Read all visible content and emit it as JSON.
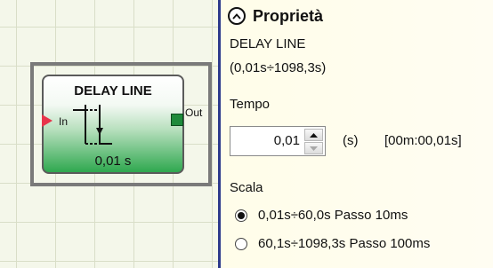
{
  "block": {
    "title": "DELAY LINE",
    "input_label": "In",
    "output_label": "Out",
    "value": "0,01 s"
  },
  "panel": {
    "header": "Proprietà",
    "name": "DELAY LINE",
    "range": "(0,01s÷1098,3s)",
    "time_label": "Tempo",
    "time_value": "0,01",
    "unit": "(s)",
    "time_formatted": "[00m:00,01s]",
    "scale_label": "Scala",
    "scale_options": [
      {
        "label": "0,01s÷60,0s Passo 10ms",
        "selected": true
      },
      {
        "label": "60,1s÷1098,3s Passo 100ms",
        "selected": false
      }
    ]
  },
  "colors": {
    "panel_divider": "#2d3a8c",
    "input_port": "#e8334a",
    "output_port": "#1e8a3b",
    "block_gradient_bottom": "#2fa84f"
  },
  "icons": [
    "collapse-chevron-icon",
    "delay-pulse-icon",
    "spin-up-icon",
    "spin-down-icon"
  ]
}
